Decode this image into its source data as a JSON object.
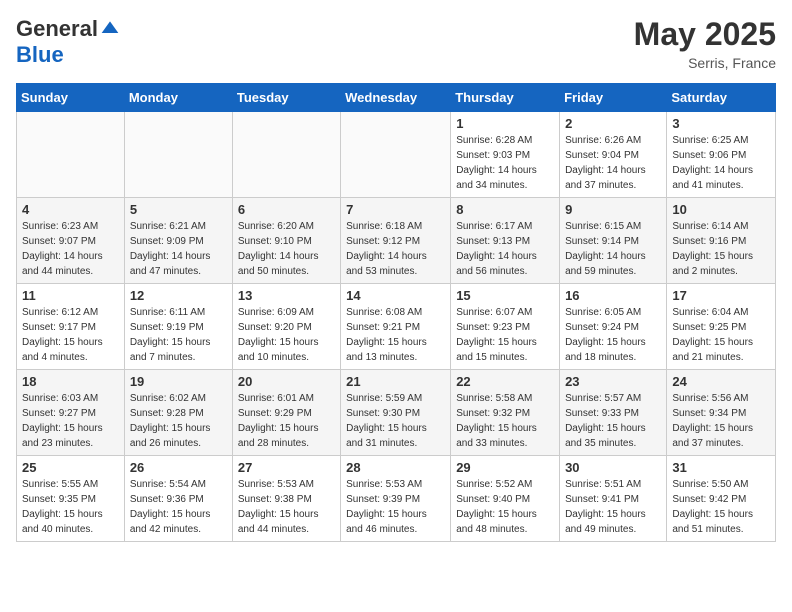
{
  "header": {
    "logo_general": "General",
    "logo_blue": "Blue",
    "month": "May 2025",
    "location": "Serris, France"
  },
  "weekdays": [
    "Sunday",
    "Monday",
    "Tuesday",
    "Wednesday",
    "Thursday",
    "Friday",
    "Saturday"
  ],
  "weeks": [
    [
      {
        "day": "",
        "info": ""
      },
      {
        "day": "",
        "info": ""
      },
      {
        "day": "",
        "info": ""
      },
      {
        "day": "",
        "info": ""
      },
      {
        "day": "1",
        "info": "Sunrise: 6:28 AM\nSunset: 9:03 PM\nDaylight: 14 hours\nand 34 minutes."
      },
      {
        "day": "2",
        "info": "Sunrise: 6:26 AM\nSunset: 9:04 PM\nDaylight: 14 hours\nand 37 minutes."
      },
      {
        "day": "3",
        "info": "Sunrise: 6:25 AM\nSunset: 9:06 PM\nDaylight: 14 hours\nand 41 minutes."
      }
    ],
    [
      {
        "day": "4",
        "info": "Sunrise: 6:23 AM\nSunset: 9:07 PM\nDaylight: 14 hours\nand 44 minutes."
      },
      {
        "day": "5",
        "info": "Sunrise: 6:21 AM\nSunset: 9:09 PM\nDaylight: 14 hours\nand 47 minutes."
      },
      {
        "day": "6",
        "info": "Sunrise: 6:20 AM\nSunset: 9:10 PM\nDaylight: 14 hours\nand 50 minutes."
      },
      {
        "day": "7",
        "info": "Sunrise: 6:18 AM\nSunset: 9:12 PM\nDaylight: 14 hours\nand 53 minutes."
      },
      {
        "day": "8",
        "info": "Sunrise: 6:17 AM\nSunset: 9:13 PM\nDaylight: 14 hours\nand 56 minutes."
      },
      {
        "day": "9",
        "info": "Sunrise: 6:15 AM\nSunset: 9:14 PM\nDaylight: 14 hours\nand 59 minutes."
      },
      {
        "day": "10",
        "info": "Sunrise: 6:14 AM\nSunset: 9:16 PM\nDaylight: 15 hours\nand 2 minutes."
      }
    ],
    [
      {
        "day": "11",
        "info": "Sunrise: 6:12 AM\nSunset: 9:17 PM\nDaylight: 15 hours\nand 4 minutes."
      },
      {
        "day": "12",
        "info": "Sunrise: 6:11 AM\nSunset: 9:19 PM\nDaylight: 15 hours\nand 7 minutes."
      },
      {
        "day": "13",
        "info": "Sunrise: 6:09 AM\nSunset: 9:20 PM\nDaylight: 15 hours\nand 10 minutes."
      },
      {
        "day": "14",
        "info": "Sunrise: 6:08 AM\nSunset: 9:21 PM\nDaylight: 15 hours\nand 13 minutes."
      },
      {
        "day": "15",
        "info": "Sunrise: 6:07 AM\nSunset: 9:23 PM\nDaylight: 15 hours\nand 15 minutes."
      },
      {
        "day": "16",
        "info": "Sunrise: 6:05 AM\nSunset: 9:24 PM\nDaylight: 15 hours\nand 18 minutes."
      },
      {
        "day": "17",
        "info": "Sunrise: 6:04 AM\nSunset: 9:25 PM\nDaylight: 15 hours\nand 21 minutes."
      }
    ],
    [
      {
        "day": "18",
        "info": "Sunrise: 6:03 AM\nSunset: 9:27 PM\nDaylight: 15 hours\nand 23 minutes."
      },
      {
        "day": "19",
        "info": "Sunrise: 6:02 AM\nSunset: 9:28 PM\nDaylight: 15 hours\nand 26 minutes."
      },
      {
        "day": "20",
        "info": "Sunrise: 6:01 AM\nSunset: 9:29 PM\nDaylight: 15 hours\nand 28 minutes."
      },
      {
        "day": "21",
        "info": "Sunrise: 5:59 AM\nSunset: 9:30 PM\nDaylight: 15 hours\nand 31 minutes."
      },
      {
        "day": "22",
        "info": "Sunrise: 5:58 AM\nSunset: 9:32 PM\nDaylight: 15 hours\nand 33 minutes."
      },
      {
        "day": "23",
        "info": "Sunrise: 5:57 AM\nSunset: 9:33 PM\nDaylight: 15 hours\nand 35 minutes."
      },
      {
        "day": "24",
        "info": "Sunrise: 5:56 AM\nSunset: 9:34 PM\nDaylight: 15 hours\nand 37 minutes."
      }
    ],
    [
      {
        "day": "25",
        "info": "Sunrise: 5:55 AM\nSunset: 9:35 PM\nDaylight: 15 hours\nand 40 minutes."
      },
      {
        "day": "26",
        "info": "Sunrise: 5:54 AM\nSunset: 9:36 PM\nDaylight: 15 hours\nand 42 minutes."
      },
      {
        "day": "27",
        "info": "Sunrise: 5:53 AM\nSunset: 9:38 PM\nDaylight: 15 hours\nand 44 minutes."
      },
      {
        "day": "28",
        "info": "Sunrise: 5:53 AM\nSunset: 9:39 PM\nDaylight: 15 hours\nand 46 minutes."
      },
      {
        "day": "29",
        "info": "Sunrise: 5:52 AM\nSunset: 9:40 PM\nDaylight: 15 hours\nand 48 minutes."
      },
      {
        "day": "30",
        "info": "Sunrise: 5:51 AM\nSunset: 9:41 PM\nDaylight: 15 hours\nand 49 minutes."
      },
      {
        "day": "31",
        "info": "Sunrise: 5:50 AM\nSunset: 9:42 PM\nDaylight: 15 hours\nand 51 minutes."
      }
    ]
  ]
}
